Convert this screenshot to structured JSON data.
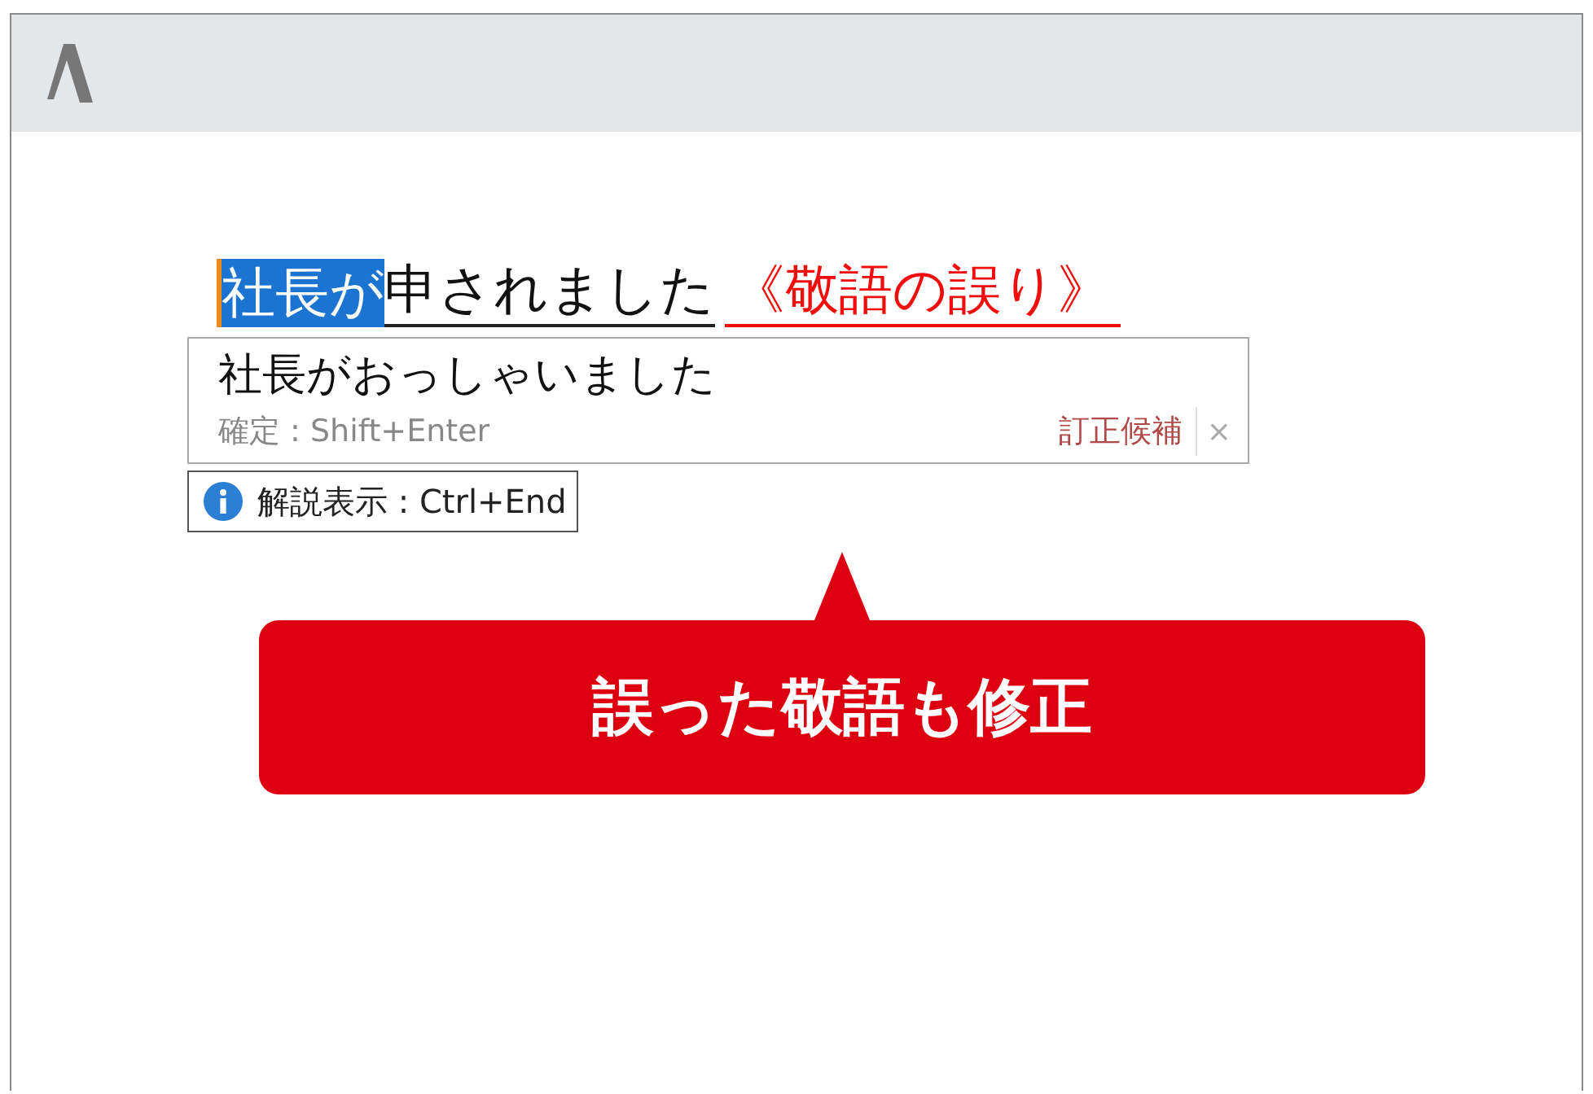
{
  "editor": {
    "sentence": [
      {
        "text": "社長が",
        "selected": true
      },
      {
        "text": "申されました",
        "selected": false
      }
    ],
    "error_label": "《敬語の誤り》"
  },
  "suggestion": {
    "text": "社長がおっしゃいました",
    "confirm_hint": "確定 : Shift+Enter",
    "label": "訂正候補",
    "close": "×"
  },
  "explanation_hint": "解説表示 : Ctrl+End",
  "callout": "誤った敬語も修正"
}
